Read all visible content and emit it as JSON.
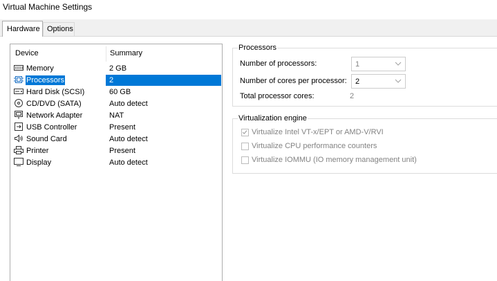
{
  "window": {
    "title": "Virtual Machine Settings"
  },
  "tabs": [
    {
      "label": "Hardware",
      "active": true
    },
    {
      "label": "Options",
      "active": false
    }
  ],
  "device_list": {
    "columns": {
      "device": "Device",
      "summary": "Summary"
    },
    "rows": [
      {
        "icon": "memory-icon",
        "device": "Memory",
        "summary": "2 GB"
      },
      {
        "icon": "processor-icon",
        "device": "Processors",
        "summary": "2",
        "selected": true
      },
      {
        "icon": "hard-disk-icon",
        "device": "Hard Disk (SCSI)",
        "summary": "60 GB"
      },
      {
        "icon": "cd-dvd-icon",
        "device": "CD/DVD (SATA)",
        "summary": "Auto detect"
      },
      {
        "icon": "network-adapter-icon",
        "device": "Network Adapter",
        "summary": "NAT"
      },
      {
        "icon": "usb-controller-icon",
        "device": "USB Controller",
        "summary": "Present"
      },
      {
        "icon": "sound-card-icon",
        "device": "Sound Card",
        "summary": "Auto detect"
      },
      {
        "icon": "printer-icon",
        "device": "Printer",
        "summary": "Present"
      },
      {
        "icon": "display-icon",
        "device": "Display",
        "summary": "Auto detect"
      }
    ]
  },
  "processors": {
    "title": "Processors",
    "num_processors_label": "Number of processors:",
    "num_processors_value": "1",
    "cores_label": "Number of cores per processor:",
    "cores_value": "2",
    "total_label": "Total processor cores:",
    "total_value": "2"
  },
  "virtualization": {
    "title": "Virtualization engine",
    "options": [
      {
        "label": "Virtualize Intel VT-x/EPT or AMD-V/RVI",
        "checked": true
      },
      {
        "label": "Virtualize CPU performance counters",
        "checked": false
      },
      {
        "label": "Virtualize IOMMU (IO memory management unit)",
        "checked": false
      }
    ]
  },
  "colors": {
    "selection": "#0078d7",
    "disabled_text": "#838383",
    "border": "#adadad"
  }
}
